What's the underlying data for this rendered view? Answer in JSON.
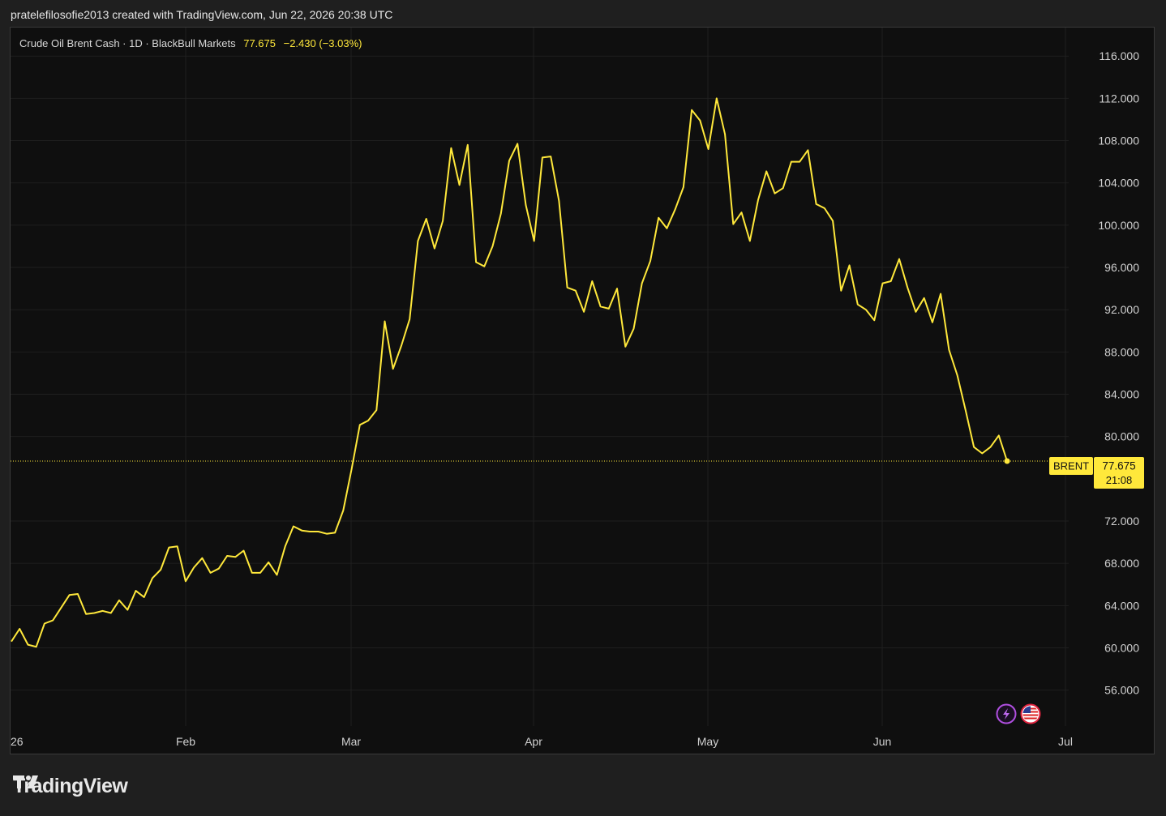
{
  "header": {
    "attribution": "pratelefilosofie2013 created with TradingView.com, Jun 22, 2026 20:38 UTC"
  },
  "legend": {
    "symbol": "Crude Oil Brent Cash · 1D · BlackBull Markets",
    "last": "77.675",
    "change": "−2.430 (−3.03%)"
  },
  "price_label": {
    "ticker": "BRENT",
    "price": "77.675",
    "countdown": "21:08"
  },
  "brand": {
    "name": "TradingView"
  },
  "colors": {
    "line": "#ffe83b",
    "background": "#0f0f0f",
    "grid": "#1f1f1f",
    "axis_text": "#d1d1d1"
  },
  "icons": [
    "lightning-icon",
    "us-flag-icon"
  ],
  "chart_data": {
    "type": "line",
    "series": [
      {
        "values": [
          60.6,
          61.8,
          60.3,
          60.1,
          62.3,
          62.6,
          63.8,
          65.0,
          65.1,
          63.2,
          63.3,
          63.5,
          63.3,
          64.5,
          63.6,
          65.4,
          64.8,
          66.6,
          67.4,
          69.5,
          69.6,
          66.3,
          67.6,
          68.5,
          67.1,
          67.5,
          68.7,
          68.6,
          69.2,
          67.1,
          67.1,
          68.1,
          66.9,
          69.6,
          71.5,
          71.1,
          71.0,
          71.0,
          70.8,
          70.9,
          73.0,
          76.9,
          81.1,
          81.5,
          82.5,
          90.9,
          86.4,
          88.6,
          91.1,
          98.5,
          100.6,
          97.8,
          100.4,
          107.3,
          103.8,
          107.6,
          96.5,
          96.1,
          98.0,
          101.1,
          106.1,
          107.7,
          101.9,
          98.5,
          106.4,
          106.5,
          102.3,
          94.1,
          93.8,
          91.8,
          94.7,
          92.3,
          92.1,
          94.0,
          88.5,
          90.2,
          94.5,
          96.6,
          100.7,
          99.7,
          101.5,
          103.6,
          110.9,
          109.9,
          107.2,
          112.0,
          108.6,
          100.1,
          101.2,
          98.5,
          102.4,
          105.1,
          103.0,
          103.5,
          106.0,
          106.0,
          107.1,
          102.0,
          101.6,
          100.4,
          93.8,
          96.2,
          92.5,
          92.0,
          91.0,
          94.5,
          94.7,
          96.8,
          94.1,
          91.8,
          93.1,
          90.8,
          93.5,
          88.2,
          85.8,
          82.5,
          79.0,
          78.4,
          79.0,
          80.1,
          77.675
        ]
      }
    ],
    "x_axis": {
      "ticks": [
        "26",
        "Feb",
        "Mar",
        "Apr",
        "May",
        "Jun",
        "Jul"
      ]
    },
    "y_axis": {
      "ticks": [
        "56.000",
        "60.000",
        "64.000",
        "68.000",
        "72.000",
        "80.000",
        "84.000",
        "88.000",
        "92.000",
        "96.000",
        "100.000",
        "104.000",
        "108.000",
        "112.000",
        "116.000"
      ],
      "range": [
        52.6,
        118.7
      ]
    },
    "last_value": 77.675,
    "grid": true,
    "legend_position": "top-left"
  }
}
